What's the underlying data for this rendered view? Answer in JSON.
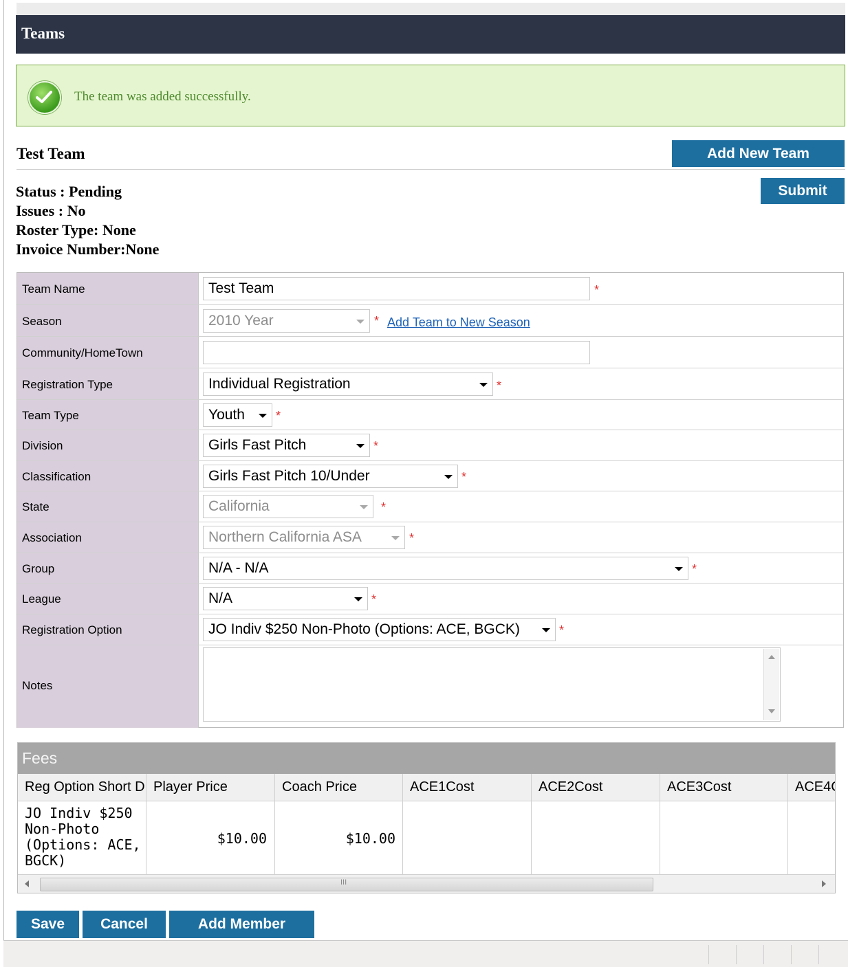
{
  "header": {
    "title": "Teams"
  },
  "success": {
    "message": "The team was added successfully."
  },
  "team": {
    "heading": "Test Team",
    "status": "Status : Pending",
    "issues": "Issues : No",
    "roster_type": "Roster Type: None",
    "invoice_number": "Invoice Number:None"
  },
  "buttons": {
    "add_new_team": "Add New Team",
    "submit": "Submit",
    "save": "Save",
    "cancel": "Cancel",
    "add_member": "Add Member"
  },
  "form": {
    "required_mark": "*",
    "team_name": {
      "label": "Team Name",
      "value": "Test Team"
    },
    "season": {
      "label": "Season",
      "value": "2010 Year",
      "link": "Add Team to New Season"
    },
    "community": {
      "label": "Community/HomeTown",
      "value": ""
    },
    "registration_type": {
      "label": "Registration Type",
      "value": "Individual Registration"
    },
    "team_type": {
      "label": "Team Type",
      "value": "Youth"
    },
    "division": {
      "label": "Division",
      "value": "Girls Fast Pitch"
    },
    "classification": {
      "label": "Classification",
      "value": "Girls Fast Pitch 10/Under"
    },
    "state": {
      "label": "State",
      "value": "California"
    },
    "association": {
      "label": "Association",
      "value": "Northern California ASA"
    },
    "group": {
      "label": "Group",
      "value": "N/A - N/A"
    },
    "league": {
      "label": "League",
      "value": "N/A"
    },
    "registration_option": {
      "label": "Registration Option",
      "value": "JO Indiv $250 Non-Photo (Options: ACE, BGCK)"
    },
    "notes": {
      "label": "Notes",
      "value": ""
    }
  },
  "fees": {
    "title": "Fees",
    "columns": [
      "Reg Option Short D",
      "Player Price",
      "Coach Price",
      "ACE1Cost",
      "ACE2Cost",
      "ACE3Cost",
      "ACE4C"
    ],
    "row": {
      "reg_option": [
        "JO Indiv $250",
        "Non-Photo",
        "(Options: ACE,",
        "BGCK)"
      ],
      "player_price": "$10.00",
      "coach_price": "$10.00"
    },
    "scroll_marker": "III"
  }
}
